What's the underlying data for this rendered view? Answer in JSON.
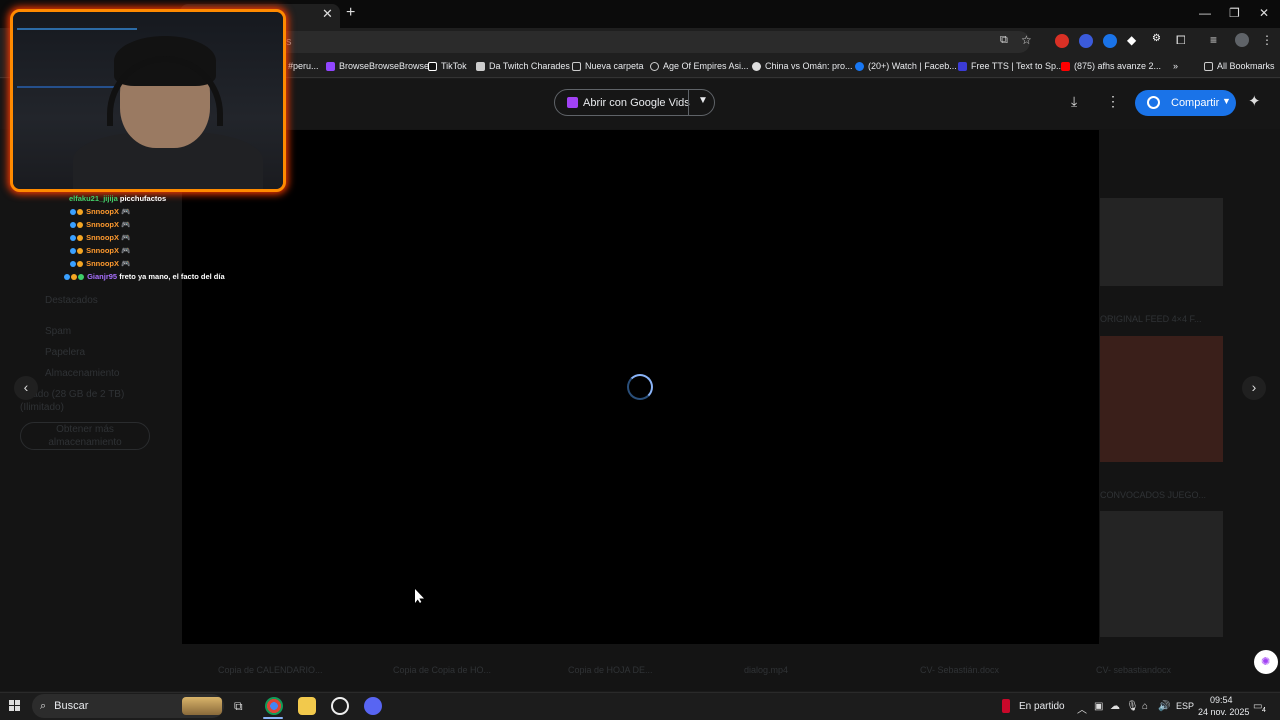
{
  "browser": {
    "omnibox_text": "s",
    "bookmarks": [
      {
        "label": "#peru...",
        "icon": "hashtag-icon"
      },
      {
        "label": "BrowseBrowseBrowse",
        "icon": "twitch-icon"
      },
      {
        "label": "TikTok",
        "icon": "tiktok-icon"
      },
      {
        "label": "Da Twitch Charades",
        "icon": "puzzle-icon"
      },
      {
        "label": "Nueva carpeta",
        "icon": "folder-icon"
      },
      {
        "label": "Age Of Empires Asi...",
        "icon": "globe-icon"
      },
      {
        "label": "China vs Omán: pro...",
        "icon": "sports-icon"
      },
      {
        "label": "(20+) Watch | Faceb...",
        "icon": "facebook-icon"
      },
      {
        "label": "Free TTS | Text to Sp...",
        "icon": "tts-icon"
      },
      {
        "label": "(875) afhs avanze 2...",
        "icon": "youtube-icon"
      }
    ],
    "all_bookmarks": "All Bookmarks",
    "overflow": "»"
  },
  "viewer": {
    "open_with_label": "Abrir con Google Vids",
    "share_label": "Compartir",
    "state": "loading"
  },
  "sidebar_dim": {
    "items": [
      "Destacados",
      "Spam",
      "Papelera",
      "Almacenamiento"
    ],
    "storage": "Usado (28 GB de 2 TB)",
    "storage_sub": "(Ilimitado)",
    "storage_button": "Obtener más almacenamiento"
  },
  "right_dim_labels": [
    "ORIGINAL FEED 4×4 F...",
    "CONVOCADOS JUEGO..."
  ],
  "file_strip": [
    "Copia de CALENDARIO...",
    "Copia de Copia de HO...",
    "Copia de HOJA DE...",
    "dialog.mp4",
    "CV- Sebastián.docx",
    "CV- sebastiandocx"
  ],
  "chat": [
    {
      "user": "elfaku21_jijija",
      "message": "picchufactos",
      "user_color": "#3fcf6a"
    },
    {
      "user": "SnnoopX",
      "message": "🎮",
      "user_color": "#ff9a2e"
    },
    {
      "user": "SnnoopX",
      "message": "🎮",
      "user_color": "#ff9a2e"
    },
    {
      "user": "SnnoopX",
      "message": "🎮",
      "user_color": "#ff9a2e"
    },
    {
      "user": "SnnoopX",
      "message": "🎮",
      "user_color": "#ff9a2e"
    },
    {
      "user": "SnnoopX",
      "message": "🎮",
      "user_color": "#ff9a2e"
    },
    {
      "user": "Gianjr95",
      "message": "freto ya mano, el facto del día",
      "user_color": "#a970ff"
    }
  ],
  "taskbar": {
    "search_label": "Buscar",
    "status_text": "En partido",
    "language": "ESP",
    "time": "09:54",
    "date": "24 nov. 2025",
    "notification_count": "4"
  },
  "colors": {
    "accent_blue": "#1a73e8",
    "webcam_border": "#ff8a00",
    "video_bg": "#000000"
  }
}
